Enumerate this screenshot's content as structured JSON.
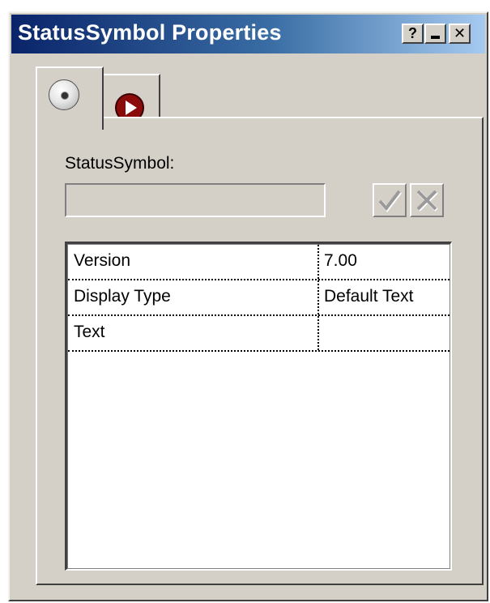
{
  "window": {
    "title": "StatusSymbol Properties",
    "help_label": "?",
    "close_label": "✕"
  },
  "tabs": [
    {
      "icon": "disk-icon",
      "selected": true
    },
    {
      "icon": "play-icon",
      "selected": false
    }
  ],
  "form": {
    "name_label": "StatusSymbol:",
    "name_value": ""
  },
  "properties": {
    "rows": [
      {
        "name": "Version",
        "value": "7.00"
      },
      {
        "name": "Display Type",
        "value": "Default Text"
      },
      {
        "name": "Text",
        "value": ""
      }
    ]
  },
  "colors": {
    "title_start": "#0a246a",
    "title_end": "#a6caf0",
    "face": "#d4d0c8",
    "play_icon": "#8b0a0a"
  }
}
